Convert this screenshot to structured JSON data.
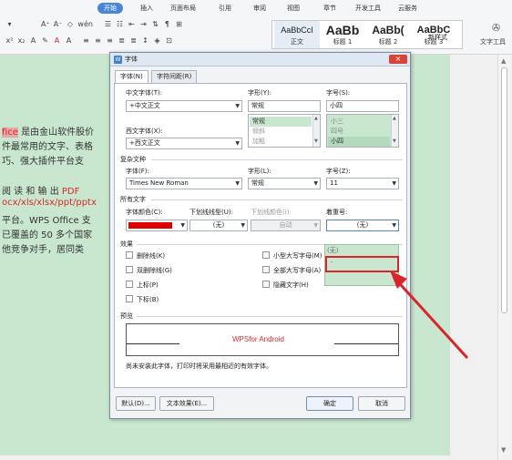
{
  "ribbon": {
    "tabs": [
      "开始",
      "插入",
      "页面布局",
      "引用",
      "审阅",
      "视图",
      "章节",
      "开发工具",
      "云服务"
    ],
    "active_tab": "开始",
    "styles": [
      {
        "sample": "AaBbCcI",
        "name": "正文"
      },
      {
        "sample": "AaBb",
        "name": "标题 1"
      },
      {
        "sample": "AaBb(",
        "name": "标题 2"
      },
      {
        "sample": "AaBbC",
        "name": "标题 3"
      }
    ],
    "new_style": "新样式",
    "text_tools": "文字工具",
    "accent_color": "#4a86d6"
  },
  "document": {
    "lines": [
      {
        "pre": "",
        "hl": "fice",
        "rest": " 是由金山软件股价"
      },
      {
        "pre": "",
        "hl": "",
        "rest": "件最常用的文字、表格"
      },
      {
        "pre": "",
        "hl": "",
        "rest": "巧、强大插件平台支"
      },
      {
        "pre": "",
        "hl": "",
        "rest": "阅 读 和 输 出  PDF"
      },
      {
        "pre": "",
        "hl": "",
        "rest": "ocx/xls/xlsx/ppt/pptx"
      },
      {
        "pre": "",
        "hl": "",
        "rest": "平台。WPS Office 支"
      },
      {
        "pre": "",
        "hl": "",
        "rest": "已覆盖的 50 多个国家"
      },
      {
        "pre": "",
        "hl": "",
        "rest": "他竞争对手，居同类"
      }
    ],
    "page_color": "#c9e7cf"
  },
  "dialog": {
    "title": "字体",
    "close": "×",
    "tabs": [
      "字体(N)",
      "字符间距(R)"
    ],
    "chinese_font": {
      "label": "中文字体(T):",
      "value": "+中文正文"
    },
    "style": {
      "label": "字形(Y):",
      "value": "常规",
      "options": [
        "常规",
        "倾斜",
        "加粗"
      ]
    },
    "size": {
      "label": "字号(S):",
      "value": "小四",
      "options": [
        "小三",
        "四号",
        "小四"
      ]
    },
    "western_font": {
      "label": "西文字体(X):",
      "value": "+西文正文"
    },
    "complex_section": "复杂文种",
    "complex_font": {
      "label": "字体(F):",
      "value": "Times New Roman"
    },
    "complex_style": {
      "label": "字形(L):",
      "value": "常规"
    },
    "complex_size": {
      "label": "字号(Z):",
      "value": "11"
    },
    "all_text_section": "所有文字",
    "font_color": {
      "label": "字体颜色(C):",
      "color": "#e00000"
    },
    "underline_type": {
      "label": "下划线线型(U):",
      "value": "(无)"
    },
    "underline_color": {
      "label": "下划线颜色(I):",
      "value": "自动"
    },
    "emphasis": {
      "label": "着重号:",
      "value": "(无)",
      "options": [
        "(无)",
        "."
      ]
    },
    "effects_section": "效果",
    "effects": [
      "删除线(K)",
      "双删除线(G)",
      "上标(P)",
      "下标(B)",
      "小型大写字母(M)",
      "全部大写字母(A)",
      "隐藏文字(H)"
    ],
    "preview_section": "预览",
    "preview_text": "WPSfor Android",
    "note": "尚未安装此字体，打印时将采用最相近的有效字体。",
    "buttons": {
      "default": "默认(D)...",
      "text_effects": "文本效果(E)...",
      "ok": "确定",
      "cancel": "取消"
    }
  },
  "annotation_color": "#d8252b"
}
